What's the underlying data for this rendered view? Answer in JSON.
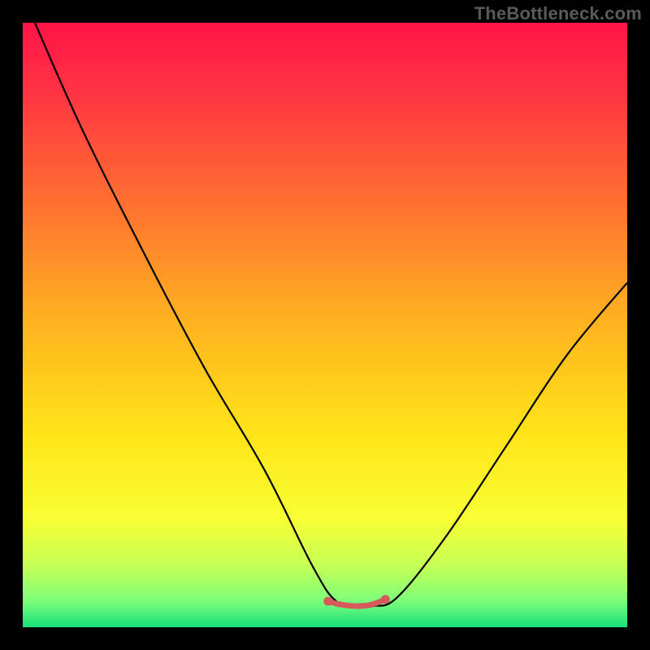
{
  "watermark": "TheBottleneck.com",
  "chart_data": {
    "type": "line",
    "title": "",
    "xlabel": "",
    "ylabel": "",
    "xlim": [
      0,
      100
    ],
    "ylim": [
      0,
      100
    ],
    "curve": {
      "x": [
        2,
        10,
        20,
        30,
        40,
        48,
        52,
        56,
        58,
        62,
        70,
        80,
        90,
        100
      ],
      "y": [
        100,
        82,
        62,
        43,
        26,
        10,
        4.2,
        3.5,
        3.5,
        5,
        15,
        30,
        45,
        57
      ]
    },
    "highlight_segment": {
      "x": [
        50.5,
        51.5,
        53,
        55,
        57,
        58.5,
        60
      ],
      "y": [
        4.3,
        4.0,
        3.7,
        3.5,
        3.6,
        4.0,
        4.6
      ]
    },
    "highlight_points": [
      {
        "x": 50.5,
        "y": 4.3
      },
      {
        "x": 60,
        "y": 4.6
      }
    ],
    "background_gradient": {
      "stops": [
        {
          "offset": 0.0,
          "color": "#ff1447"
        },
        {
          "offset": 0.1,
          "color": "#ff2f44"
        },
        {
          "offset": 0.28,
          "color": "#ff6a32"
        },
        {
          "offset": 0.5,
          "color": "#ffb41f"
        },
        {
          "offset": 0.68,
          "color": "#ffe418"
        },
        {
          "offset": 0.82,
          "color": "#f8ff33"
        },
        {
          "offset": 0.9,
          "color": "#c4ff56"
        },
        {
          "offset": 0.955,
          "color": "#7fff7a"
        },
        {
          "offset": 1.0,
          "color": "#18e07a"
        }
      ]
    },
    "colors": {
      "curve": "#000000",
      "highlight": "#d65a5a"
    }
  }
}
